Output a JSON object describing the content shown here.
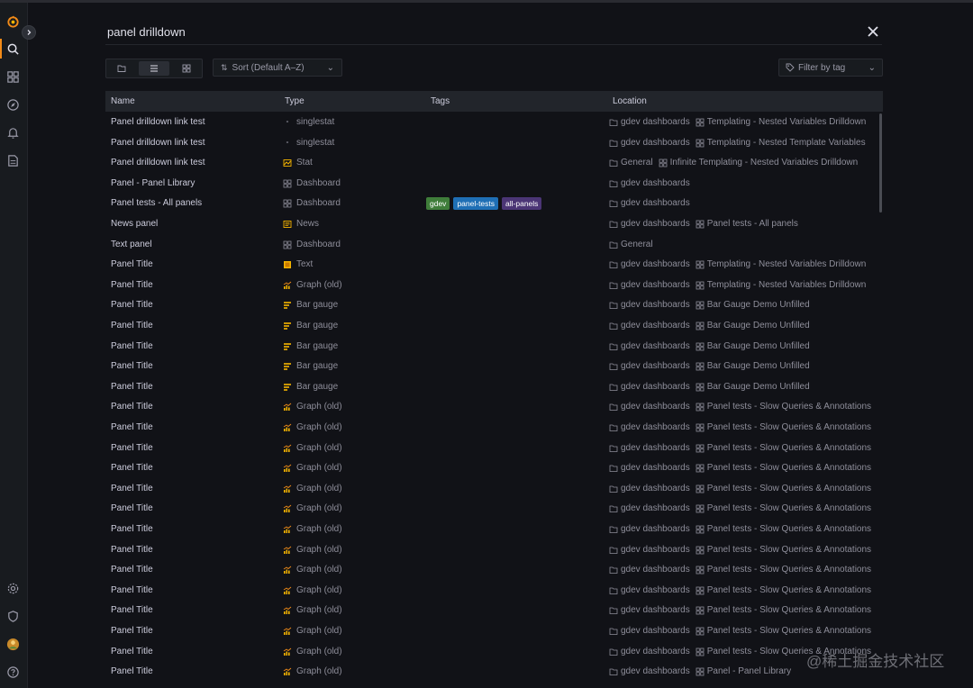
{
  "search": {
    "query": "panel drilldown",
    "close_icon": "close-icon"
  },
  "toolbar": {
    "views": [
      "folder-view-icon",
      "list-view-icon",
      "grid-view-icon"
    ],
    "sort_label": "Sort (Default A–Z)",
    "tag_filter_placeholder": "Filter by tag"
  },
  "sidebar": {
    "icons": [
      "grafana-logo",
      "search-icon",
      "dashboards-icon",
      "explore-icon",
      "alerting-icon",
      "reports-icon",
      "settings-icon",
      "shield-icon",
      "avatar",
      "help-icon"
    ]
  },
  "table": {
    "headers": {
      "name": "Name",
      "type": "Type",
      "tags": "Tags",
      "location": "Location"
    },
    "rows": [
      {
        "name": "Panel drilldown link test",
        "type": "singlestat",
        "type_icon": "singlestat-icon",
        "tags": [],
        "loc_folder": "gdev dashboards",
        "loc_dash": "Templating - Nested Variables Drilldown"
      },
      {
        "name": "Panel drilldown link test",
        "type": "singlestat",
        "type_icon": "singlestat-icon",
        "tags": [],
        "loc_folder": "gdev dashboards",
        "loc_dash": "Templating - Nested Template Variables"
      },
      {
        "name": "Panel drilldown link test",
        "type": "Stat",
        "type_icon": "stat-icon",
        "tags": [],
        "loc_folder": "General",
        "loc_dash": "Infinite Templating - Nested Variables Drilldown"
      },
      {
        "name": "Panel - Panel Library",
        "type": "Dashboard",
        "type_icon": "dashboard-icon",
        "tags": [],
        "loc_folder": "gdev dashboards",
        "loc_dash": ""
      },
      {
        "name": "Panel tests - All panels",
        "type": "Dashboard",
        "type_icon": "dashboard-icon",
        "tags": [
          {
            "label": "gdev",
            "color": "#3f7d3a"
          },
          {
            "label": "panel-tests",
            "color": "#1f6fb5"
          },
          {
            "label": "all-panels",
            "color": "#4b3575"
          }
        ],
        "loc_folder": "gdev dashboards",
        "loc_dash": ""
      },
      {
        "name": "News panel",
        "type": "News",
        "type_icon": "news-icon",
        "tags": [],
        "loc_folder": "gdev dashboards",
        "loc_dash": "Panel tests - All panels"
      },
      {
        "name": "Text panel",
        "type": "Dashboard",
        "type_icon": "dashboard-icon",
        "tags": [],
        "loc_folder": "General",
        "loc_dash": ""
      },
      {
        "name": "Panel Title",
        "type": "Text",
        "type_icon": "text-icon",
        "tags": [],
        "loc_folder": "gdev dashboards",
        "loc_dash": "Templating - Nested Variables Drilldown"
      },
      {
        "name": "Panel Title",
        "type": "Graph (old)",
        "type_icon": "graph-icon",
        "tags": [],
        "loc_folder": "gdev dashboards",
        "loc_dash": "Templating - Nested Variables Drilldown"
      },
      {
        "name": "Panel Title",
        "type": "Bar gauge",
        "type_icon": "bar-gauge-icon",
        "tags": [],
        "loc_folder": "gdev dashboards",
        "loc_dash": "Bar Gauge Demo Unfilled"
      },
      {
        "name": "Panel Title",
        "type": "Bar gauge",
        "type_icon": "bar-gauge-icon",
        "tags": [],
        "loc_folder": "gdev dashboards",
        "loc_dash": "Bar Gauge Demo Unfilled"
      },
      {
        "name": "Panel Title",
        "type": "Bar gauge",
        "type_icon": "bar-gauge-icon",
        "tags": [],
        "loc_folder": "gdev dashboards",
        "loc_dash": "Bar Gauge Demo Unfilled"
      },
      {
        "name": "Panel Title",
        "type": "Bar gauge",
        "type_icon": "bar-gauge-icon",
        "tags": [],
        "loc_folder": "gdev dashboards",
        "loc_dash": "Bar Gauge Demo Unfilled"
      },
      {
        "name": "Panel Title",
        "type": "Bar gauge",
        "type_icon": "bar-gauge-icon",
        "tags": [],
        "loc_folder": "gdev dashboards",
        "loc_dash": "Bar Gauge Demo Unfilled"
      },
      {
        "name": "Panel Title",
        "type": "Graph (old)",
        "type_icon": "graph-icon",
        "tags": [],
        "loc_folder": "gdev dashboards",
        "loc_dash": "Panel tests - Slow Queries & Annotations"
      },
      {
        "name": "Panel Title",
        "type": "Graph (old)",
        "type_icon": "graph-icon",
        "tags": [],
        "loc_folder": "gdev dashboards",
        "loc_dash": "Panel tests - Slow Queries & Annotations"
      },
      {
        "name": "Panel Title",
        "type": "Graph (old)",
        "type_icon": "graph-icon",
        "tags": [],
        "loc_folder": "gdev dashboards",
        "loc_dash": "Panel tests - Slow Queries & Annotations"
      },
      {
        "name": "Panel Title",
        "type": "Graph (old)",
        "type_icon": "graph-icon",
        "tags": [],
        "loc_folder": "gdev dashboards",
        "loc_dash": "Panel tests - Slow Queries & Annotations"
      },
      {
        "name": "Panel Title",
        "type": "Graph (old)",
        "type_icon": "graph-icon",
        "tags": [],
        "loc_folder": "gdev dashboards",
        "loc_dash": "Panel tests - Slow Queries & Annotations"
      },
      {
        "name": "Panel Title",
        "type": "Graph (old)",
        "type_icon": "graph-icon",
        "tags": [],
        "loc_folder": "gdev dashboards",
        "loc_dash": "Panel tests - Slow Queries & Annotations"
      },
      {
        "name": "Panel Title",
        "type": "Graph (old)",
        "type_icon": "graph-icon",
        "tags": [],
        "loc_folder": "gdev dashboards",
        "loc_dash": "Panel tests - Slow Queries & Annotations"
      },
      {
        "name": "Panel Title",
        "type": "Graph (old)",
        "type_icon": "graph-icon",
        "tags": [],
        "loc_folder": "gdev dashboards",
        "loc_dash": "Panel tests - Slow Queries & Annotations"
      },
      {
        "name": "Panel Title",
        "type": "Graph (old)",
        "type_icon": "graph-icon",
        "tags": [],
        "loc_folder": "gdev dashboards",
        "loc_dash": "Panel tests - Slow Queries & Annotations"
      },
      {
        "name": "Panel Title",
        "type": "Graph (old)",
        "type_icon": "graph-icon",
        "tags": [],
        "loc_folder": "gdev dashboards",
        "loc_dash": "Panel tests - Slow Queries & Annotations"
      },
      {
        "name": "Panel Title",
        "type": "Graph (old)",
        "type_icon": "graph-icon",
        "tags": [],
        "loc_folder": "gdev dashboards",
        "loc_dash": "Panel tests - Slow Queries & Annotations"
      },
      {
        "name": "Panel Title",
        "type": "Graph (old)",
        "type_icon": "graph-icon",
        "tags": [],
        "loc_folder": "gdev dashboards",
        "loc_dash": "Panel tests - Slow Queries & Annotations"
      },
      {
        "name": "Panel Title",
        "type": "Graph (old)",
        "type_icon": "graph-icon",
        "tags": [],
        "loc_folder": "gdev dashboards",
        "loc_dash": "Panel tests - Slow Queries & Annotations"
      },
      {
        "name": "Panel Title",
        "type": "Graph (old)",
        "type_icon": "graph-icon",
        "tags": [],
        "loc_folder": "gdev dashboards",
        "loc_dash": "Panel - Panel Library"
      }
    ]
  },
  "watermark": "@稀土掘金技术社区",
  "colors": {
    "accent": "#f28b18",
    "background": "#111217",
    "header": "#22252b",
    "sidebar": "#181b1f"
  }
}
